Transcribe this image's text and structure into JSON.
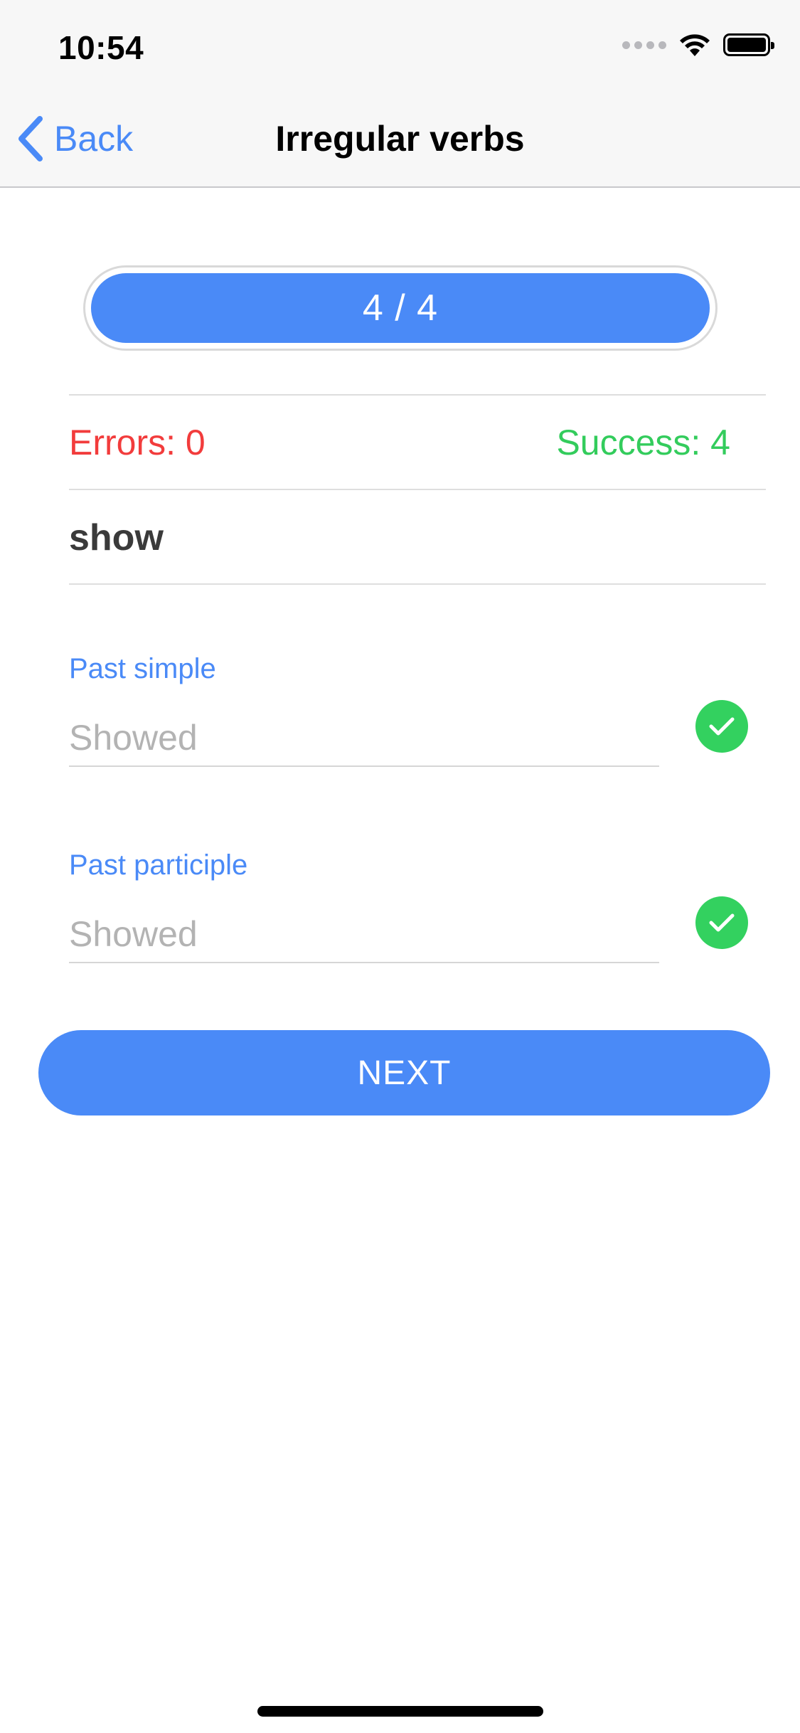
{
  "status_bar": {
    "time": "10:54",
    "icons": [
      "signal-dots-icon",
      "wifi-icon",
      "battery-icon"
    ]
  },
  "nav": {
    "back_label": "Back",
    "back_icon": "chevron-left-icon",
    "title": "Irregular verbs"
  },
  "progress": {
    "label": "4 / 4",
    "current": 4,
    "total": 4,
    "fraction": 1.0
  },
  "stats": {
    "errors_label": "Errors: 0",
    "success_label": "Success: 4"
  },
  "verb": "show",
  "fields": [
    {
      "label": "Past simple",
      "value": "Showed",
      "status": "correct",
      "status_icon": "check-circle-icon"
    },
    {
      "label": "Past participle",
      "value": "Showed",
      "status": "correct",
      "status_icon": "check-circle-icon"
    }
  ],
  "next_button": {
    "label": "NEXT"
  },
  "colors": {
    "accent": "#4a8af7",
    "error": "#f23c3c",
    "success": "#33cc5c",
    "check": "#33d15f",
    "input_text": "#b3b3b3"
  }
}
